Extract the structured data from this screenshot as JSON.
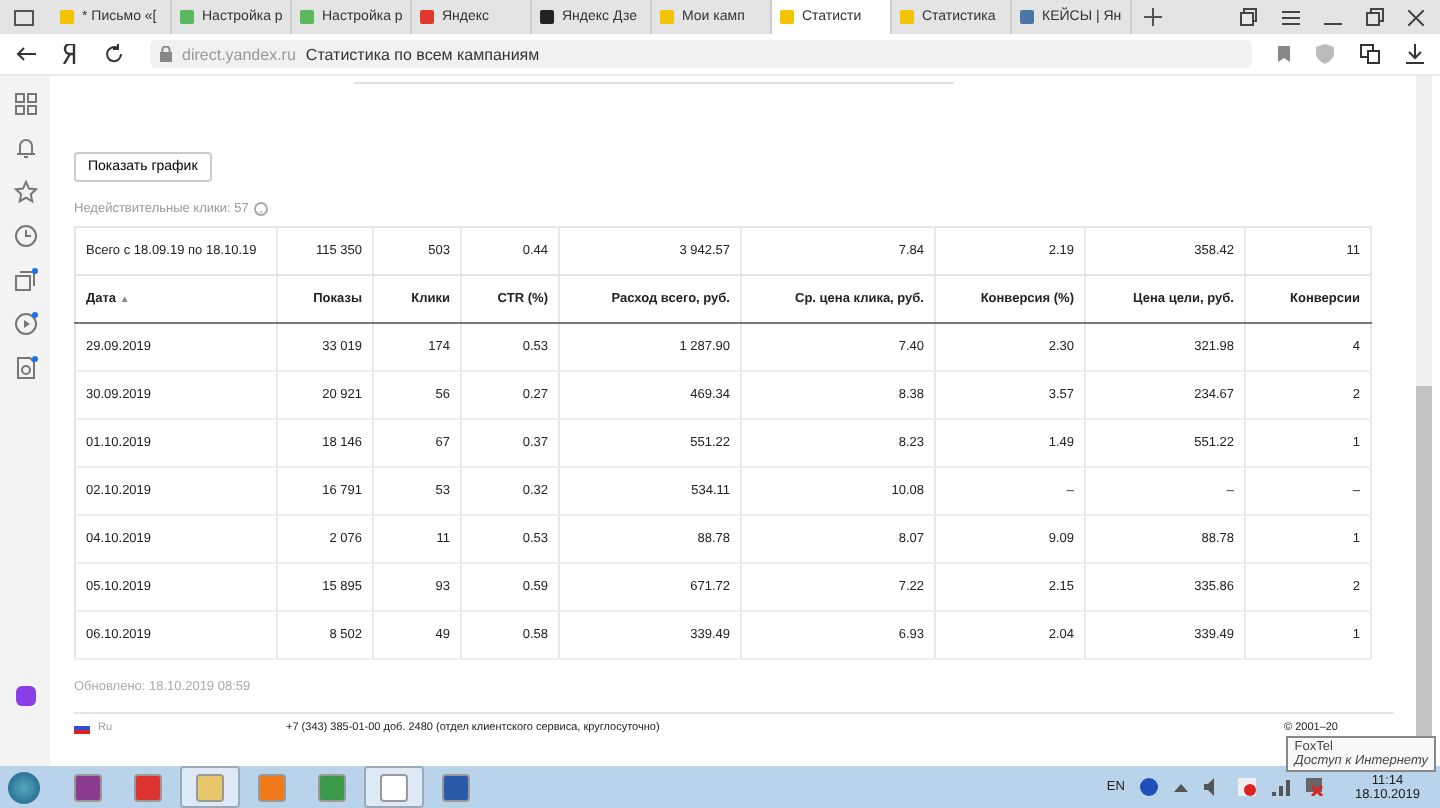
{
  "tabs": [
    {
      "title": "* Письмо «[",
      "kind": "mail",
      "selected": false
    },
    {
      "title": "Настройка р",
      "kind": "leaf",
      "selected": false
    },
    {
      "title": "Настройка р",
      "kind": "leaf",
      "selected": false
    },
    {
      "title": "Яндекс",
      "kind": "ya",
      "selected": false
    },
    {
      "title": "Яндекс Дзе",
      "kind": "zen",
      "selected": false
    },
    {
      "title": "Мои камп",
      "kind": "direct",
      "selected": false
    },
    {
      "title": "Статисти",
      "kind": "direct",
      "selected": true
    },
    {
      "title": "Статистика",
      "kind": "direct",
      "selected": false
    },
    {
      "title": "КЕЙСЫ | Ян",
      "kind": "vk",
      "selected": false
    }
  ],
  "address": {
    "host": "direct.yandex.ru",
    "title": "Статистика по всем кампаниям"
  },
  "sidebar": [
    {
      "kind": "grid",
      "dot": false
    },
    {
      "kind": "bell",
      "dot": false
    },
    {
      "kind": "star",
      "dot": false
    },
    {
      "kind": "clock",
      "dot": false
    },
    {
      "kind": "cards",
      "dot": true
    },
    {
      "kind": "play",
      "dot": true
    },
    {
      "kind": "doc",
      "dot": true
    }
  ],
  "show_chart_button": "Показать график",
  "invalid_clicks": "Недействительные клики: 57",
  "table": {
    "total": [
      "Всего с 18.09.19 по 18.10.19",
      "115 350",
      "503",
      "0.44",
      "3 942.57",
      "7.84",
      "2.19",
      "358.42",
      "11"
    ],
    "columns": [
      "Дата",
      "Показы",
      "Клики",
      "CTR (%)",
      "Расход всего, руб.",
      "Ср. цена клика, руб.",
      "Конверсия (%)",
      "Цена цели, руб.",
      "Конверсии"
    ],
    "sort_mark": "▲",
    "rows": [
      [
        "29.09.2019",
        "33 019",
        "174",
        "0.53",
        "1 287.90",
        "7.40",
        "2.30",
        "321.98",
        "4"
      ],
      [
        "30.09.2019",
        "20 921",
        "56",
        "0.27",
        "469.34",
        "8.38",
        "3.57",
        "234.67",
        "2"
      ],
      [
        "01.10.2019",
        "18 146",
        "67",
        "0.37",
        "551.22",
        "8.23",
        "1.49",
        "551.22",
        "1"
      ],
      [
        "02.10.2019",
        "16 791",
        "53",
        "0.32",
        "534.11",
        "10.08",
        "–",
        "–",
        "–"
      ],
      [
        "04.10.2019",
        "2 076",
        "11",
        "0.53",
        "88.78",
        "8.07",
        "9.09",
        "88.78",
        "1"
      ],
      [
        "05.10.2019",
        "15 895",
        "93",
        "0.59",
        "671.72",
        "7.22",
        "2.15",
        "335.86",
        "2"
      ],
      [
        "06.10.2019",
        "8 502",
        "49",
        "0.58",
        "339.49",
        "6.93",
        "2.04",
        "339.49",
        "1"
      ]
    ]
  },
  "updated": "Обновлено: 18.10.2019 08:59",
  "footer": {
    "lang": "Ru",
    "phone": "+7 (343) 385-01-00 доб. 2480 (отдел клиентского сервиса, круглосуточно)",
    "copyright": "© 2001–20"
  },
  "tooltip": {
    "title": "FoxTel",
    "text": "Доступ к Интернету"
  },
  "taskbar": [
    {
      "kind": "winrar",
      "active": false
    },
    {
      "kind": "red",
      "active": false
    },
    {
      "kind": "folder",
      "active": true
    },
    {
      "kind": "firefox",
      "active": false
    },
    {
      "kind": "chrome",
      "active": false
    },
    {
      "kind": "yandex",
      "active": true
    },
    {
      "kind": "pc",
      "active": false
    }
  ],
  "tray": {
    "lang": "EN",
    "time": "11:14",
    "date": "18.10.2019"
  }
}
